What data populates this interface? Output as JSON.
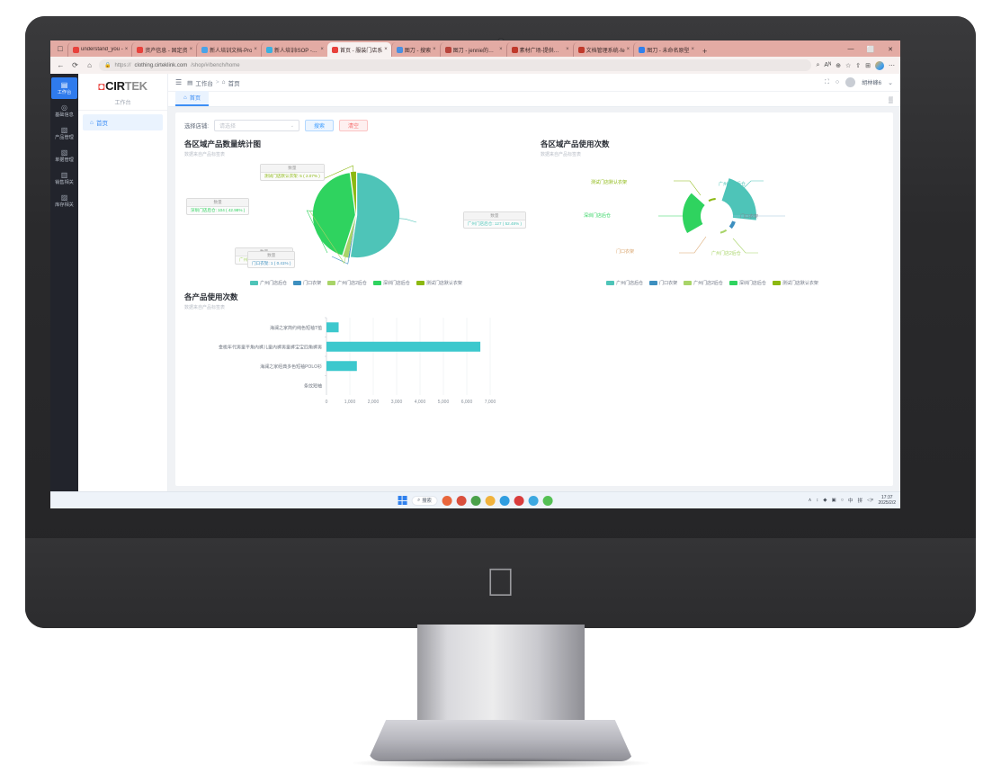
{
  "browser": {
    "tabs": [
      {
        "title": "understand_you -",
        "favicon": "#e8413c",
        "active": false
      },
      {
        "title": "资产信息 - 固定资",
        "favicon": "#e8413c",
        "active": false
      },
      {
        "title": "新人培训文档-Pro",
        "favicon": "#4aa3e8",
        "active": false
      },
      {
        "title": "新人培训ISOP - 飞书",
        "favicon": "#3ab0e0",
        "active": false
      },
      {
        "title": "首页 - 服装门店系",
        "favicon": "#e8413c",
        "active": true
      },
      {
        "title": "图刀 - 搜索",
        "favicon": "#4a8fe0",
        "active": false
      },
      {
        "title": "图刀 - jennie的企业",
        "favicon": "#b8443c",
        "active": false
      },
      {
        "title": "素材广场-提供高质",
        "favicon": "#c0392b",
        "active": false
      },
      {
        "title": "文档管理系统-fe",
        "favicon": "#c0392b",
        "active": false
      },
      {
        "title": "图刀 - 未命名原型",
        "favicon": "#2f80ed",
        "active": false
      }
    ],
    "new_tab_label": "+",
    "window_controls": [
      "—",
      "⬜",
      "✕"
    ],
    "url_secure": "https://",
    "url_domain": "clothing.cirteklink.com",
    "url_path": "/shop/#/bench/home",
    "nav": {
      "back": "←",
      "reload": "⟳",
      "home": "⌂",
      "lock": "☰"
    },
    "toolbar_right": [
      "⌕",
      "Aᴺ",
      "⊕",
      "☆",
      "⇧",
      "⊞",
      "⋯"
    ]
  },
  "sidebar": {
    "items": [
      {
        "icon": "▤",
        "label": "工作台",
        "active": true
      },
      {
        "icon": "◎",
        "label": "基础信息",
        "active": false
      },
      {
        "icon": "▧",
        "label": "产品管理",
        "active": false
      },
      {
        "icon": "▧",
        "label": "单据管理",
        "active": false
      },
      {
        "icon": "▥",
        "label": "销售相关",
        "active": false
      },
      {
        "icon": "▨",
        "label": "库存相关",
        "active": false
      }
    ]
  },
  "submenu": {
    "brand_cir": "CIR",
    "brand_tek": "TEK",
    "title": "工作台",
    "items": [
      {
        "icon": "⌂",
        "label": "首页"
      }
    ]
  },
  "topbar": {
    "collapse_icon": "☰",
    "breadcrumb": [
      {
        "icon": "▤",
        "label": "工作台"
      },
      {
        "icon": "⌂",
        "label": "首页"
      }
    ],
    "separator": ">",
    "fullscreen_icon": "⛶",
    "refresh_icon": "○",
    "username": "胡林峰6",
    "user_caret": "⌄"
  },
  "page_tab": {
    "icon": "⌂",
    "label": "首页",
    "grid_icon": "▒"
  },
  "filter": {
    "label": "选择店铺:",
    "placeholder": "请选择",
    "value": "",
    "caret": "⌄",
    "search_button": "搜索",
    "clear_button": "清空"
  },
  "colors": {
    "teal": "#4ec4b8",
    "blue": "#3d8fbf",
    "lightgreen": "#a8d468",
    "green": "#2fd35f",
    "olive": "#8cb811",
    "bar": "#3cc8cd",
    "accent": "#3d8ef5"
  },
  "chart_data": [
    {
      "type": "pie",
      "title": "各区域产品数量统计图",
      "subtitle": "数据来自产品标签表",
      "value_header": "数量",
      "legend_position": "bottom",
      "categories": [
        "广州门店后仓",
        "门口衣架",
        "广州门店2后仓",
        "深圳门店后仓",
        "测试门店默认衣架"
      ],
      "values": [
        127,
        1,
        5,
        104,
        5
      ],
      "colors": [
        "#4ec4b8",
        "#3d8fbf",
        "#a8d468",
        "#2fd35f",
        "#8cb811"
      ],
      "labels": [
        {
          "name": "测试门店默认衣架",
          "value": 5,
          "percent": "2.07%",
          "text": "测试门店默认衣架: 5 ( 2.07% )",
          "color": "#8cb811"
        },
        {
          "name": "深圳门店后仓",
          "value": 104,
          "percent": "42.98%",
          "text": "深圳门店后仓: 104 ( 42.98% )",
          "color": "#2fd35f"
        },
        {
          "name": "广州门店后仓",
          "value": 127,
          "percent": "52.48%",
          "text": "广州门店后仓: 127 ( 52.48% )",
          "color": "#4ec4b8"
        },
        {
          "name": "门口衣架",
          "value": 1,
          "percent": "0.41%",
          "text": "门口衣架: 1 ( 0.41% )",
          "color": "#3d8fbf"
        },
        {
          "name": "广州门店2后仓",
          "value": 5,
          "percent": "2.07%",
          "text": "广州门店2后仓: 5 ( 2.07% )",
          "color": "#a8d468"
        }
      ]
    },
    {
      "type": "pie",
      "title": "各区域产品使用次数",
      "subtitle": "数据来自产品标签表",
      "legend_position": "bottom",
      "categories": [
        "广州门店后仓",
        "门口衣架",
        "广州门店2后仓",
        "深圳门店后仓",
        "测试门店默认衣架"
      ],
      "values": [
        70,
        1,
        1,
        55,
        1
      ],
      "colors": [
        "#4ec4b8",
        "#3d8fbf",
        "#a8d468",
        "#2fd35f",
        "#8cb811"
      ],
      "labels": [
        {
          "name": "测试门店默认衣架",
          "color": "#8cb811"
        },
        {
          "name": "广州门店后仓",
          "color": "#4ec4b8"
        },
        {
          "name": "深圳门店后仓",
          "color": "#2fd35f"
        },
        {
          "name": "门口衣架",
          "color": "#d9a46c"
        },
        {
          "name": "广州门店2后仓",
          "color": "#a8d468"
        }
      ]
    },
    {
      "type": "bar",
      "orientation": "horizontal",
      "title": "各产品使用次数",
      "subtitle": "数据来自产品标签表",
      "categories": [
        "海澜之家简约纯色短袖T恤",
        "金桃年代男童平角内裤儿童内裤男童裤宝宝四角裤男",
        "海澜之家经典多色短袖POLO衫",
        "条纹短袖"
      ],
      "values": [
        520,
        6580,
        1300,
        0
      ],
      "xlabel": "",
      "ylabel": "",
      "xticks": [
        "0",
        "1,000",
        "2,000",
        "3,000",
        "4,000",
        "5,000",
        "6,000",
        "7,000"
      ],
      "xlim": [
        0,
        7000
      ],
      "grid": true,
      "color": "#3cc8cd"
    }
  ],
  "taskbar": {
    "search_icon": "⌕",
    "search_label": "搜索",
    "apps": [
      {
        "name": "firefox-icon",
        "color": "#e8663c"
      },
      {
        "name": "notes-icon",
        "color": "#d94f3d"
      },
      {
        "name": "chrome-icon",
        "color": "#4aa14a"
      },
      {
        "name": "explorer-icon",
        "color": "#f0b23c"
      },
      {
        "name": "edge-icon",
        "color": "#2f9de0"
      },
      {
        "name": "wps-icon",
        "color": "#d93c3c"
      },
      {
        "name": "qq-icon",
        "color": "#3ca8e0"
      },
      {
        "name": "app-icon",
        "color": "#54c054"
      }
    ],
    "tray": [
      "∧",
      "↕",
      "◆",
      "▣",
      "○"
    ],
    "tray2": [
      "▢",
      "0",
      "●",
      "中",
      "拼",
      "□",
      "◁×"
    ],
    "time": "17:37",
    "date": "2025/2/2"
  },
  "desktop": {
    "apple_logo": ""
  }
}
